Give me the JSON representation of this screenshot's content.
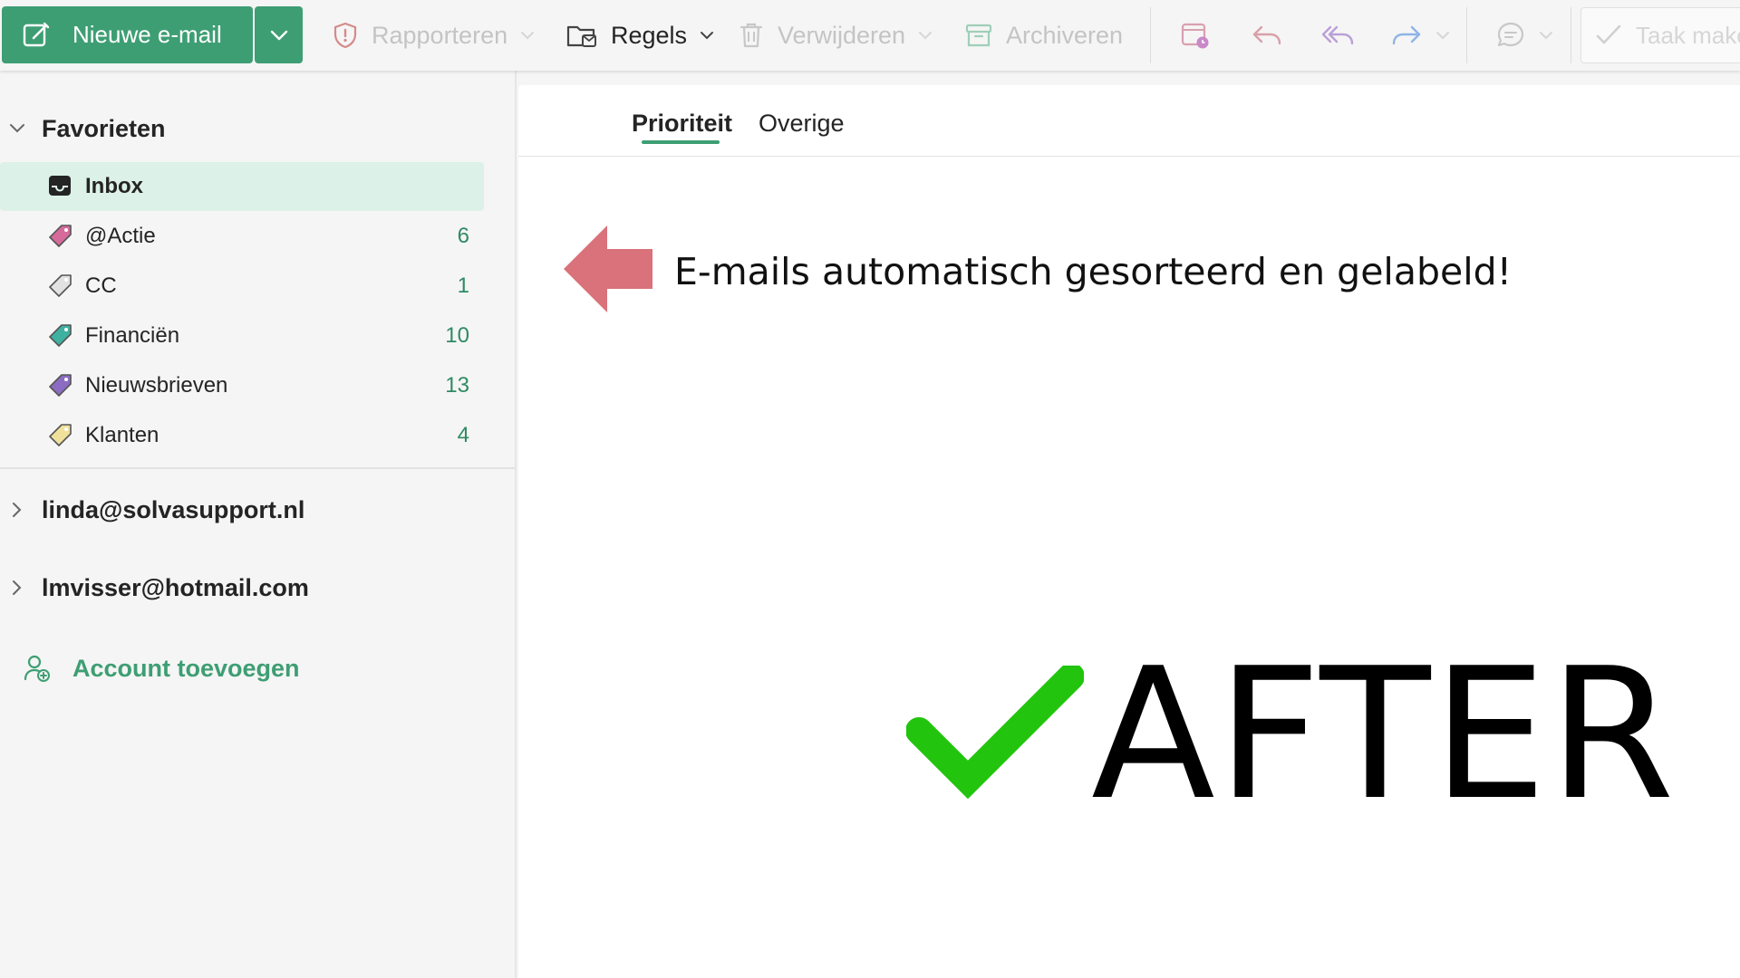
{
  "toolbar": {
    "new_mail": "Nieuwe e-mail",
    "report": "Rapporteren",
    "rules": "Regels",
    "delete": "Verwijderen",
    "archive": "Archiveren",
    "task_partial": "Taak make"
  },
  "sidebar": {
    "favorites_label": "Favorieten",
    "folders": [
      {
        "label": "Inbox",
        "count": "",
        "tag_color": ""
      },
      {
        "label": "@Actie",
        "count": "6",
        "tag_color": "#d56a9b"
      },
      {
        "label": "CC",
        "count": "1",
        "tag_color": "#c9c9c9"
      },
      {
        "label": "Financiën",
        "count": "10",
        "tag_color": "#3fb1a0"
      },
      {
        "label": "Nieuwsbrieven",
        "count": "13",
        "tag_color": "#8c6cc2"
      },
      {
        "label": "Klanten",
        "count": "4",
        "tag_color": "#e9d98a"
      }
    ],
    "accounts": [
      {
        "label": "linda@solvasupport.nl"
      },
      {
        "label": "lmvisser@hotmail.com"
      }
    ],
    "add_account": "Account toevoegen"
  },
  "main": {
    "tabs": [
      {
        "label": "Prioriteit",
        "active": true
      },
      {
        "label": "Overige",
        "active": false
      }
    ],
    "annotation_text": "E-mails automatisch gesorteerd en gelabeld!",
    "after_label": "AFTER"
  },
  "colors": {
    "accent": "#3e9e73",
    "selected_bg": "#dcf1e8",
    "arrow": "#d9727a",
    "check": "#22c40e"
  }
}
